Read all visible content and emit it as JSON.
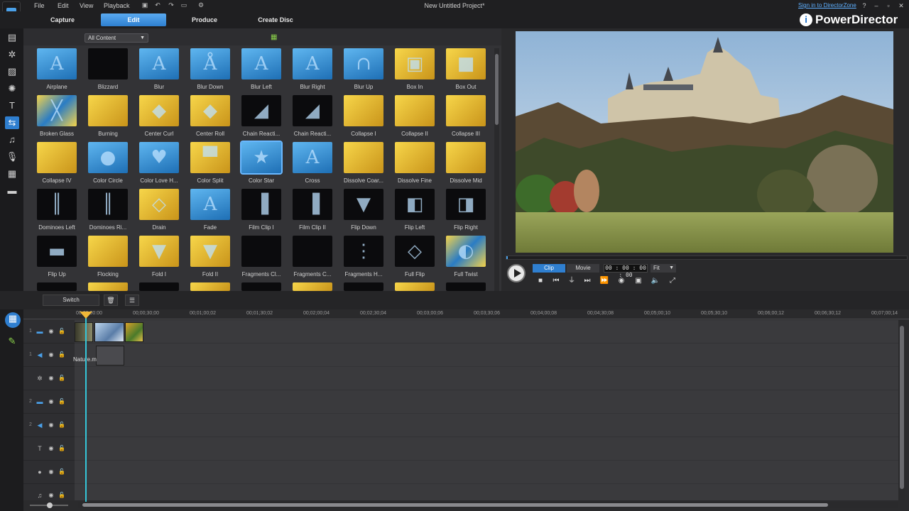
{
  "menu": [
    "File",
    "Edit",
    "View",
    "Playback"
  ],
  "window": {
    "title": "New Untitled Project*",
    "signin": "Sign in to DirectorZone",
    "help": "?",
    "minimize": "–",
    "maximize": "▫",
    "close": "✕"
  },
  "modes": [
    "Capture",
    "Edit",
    "Produce",
    "Create Disc"
  ],
  "brand": {
    "name": "PowerDirector",
    "icon": "i"
  },
  "library": {
    "filter": "All Content",
    "transitions": [
      "Airplane",
      "Blizzard",
      "Blur",
      "Blur Down",
      "Blur Left",
      "Blur Right",
      "Blur Up",
      "Box In",
      "Box Out",
      "Broken Glass",
      "Burning",
      "Center Curl",
      "Center Roll",
      "Chain Reacti...",
      "Chain Reacti...",
      "Collapse I",
      "Collapse II",
      "Collapse III",
      "Collapse IV",
      "Color Circle",
      "Color Love H...",
      "Color Split",
      "Color Star",
      "Cross",
      "Dissolve Coar...",
      "Dissolve Fine",
      "Dissolve Mid",
      "Dominoes Left",
      "Dominoes Ri...",
      "Drain",
      "Fade",
      "Film Clip I",
      "Film Clip II",
      "Flip Down",
      "Flip Left",
      "Flip Right",
      "Flip Up",
      "Flocking",
      "Fold I",
      "Fold II",
      "Fragments Cl...",
      "Fragments C...",
      "Fragments H...",
      "Full Flip",
      "Full Twist"
    ],
    "selected_transition": "Color Star"
  },
  "preview": {
    "clip_tab": "Clip",
    "movie_tab": "Movie",
    "timecode": "00 : 00 : 00 : 00",
    "fit": "Fit",
    "progress": 0.0
  },
  "timeline": {
    "switch_label": "Switch",
    "ruler": [
      "00:00:00:00",
      "00;00;30;00",
      "00;01;00;02",
      "00;01;30;02",
      "00;02;00;04",
      "00;02;30;04",
      "00;03;00;06",
      "00;03;30;06",
      "00;04;00;08",
      "00;04;30;08",
      "00;05;00;10",
      "00;05;30;10",
      "00;06;00;12",
      "00;06;30;12",
      "00;07;00;14"
    ],
    "audio_clip_label": "Nature.m"
  },
  "icons": {
    "accent": "#2f7fd0",
    "playhead": "#35c6d8",
    "brand_text": "#ffffff"
  }
}
